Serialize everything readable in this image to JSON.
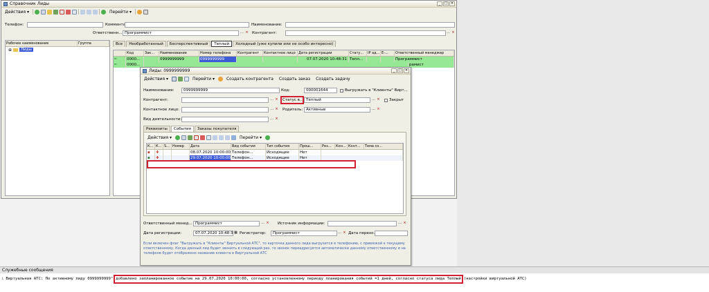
{
  "main_window": {
    "title": "Справочник Лиды",
    "toolbar": {
      "actions_label": "Действия",
      "goto_label": "Перейти"
    },
    "filters": {
      "phone_label": "Телефон:",
      "comment_label": "Комментарий:",
      "name_label": "Наименование:",
      "responsible_label": "Ответственн...",
      "responsible_value": "Программист",
      "counterparty_label": "Контрагент:"
    },
    "tree": {
      "col_name": "Рабочее наименование",
      "col_group": "Группа",
      "root_label": "Лиды"
    },
    "status_tabs": [
      "Все",
      "Необработанный",
      "Бесперспективный",
      "Теплый",
      "Холодный (уже купили или не особо интересно)"
    ],
    "columns": [
      "Код",
      "Зак...",
      "Наименование",
      "Номер телефона",
      "Контрагент",
      "Контактное лицо",
      "Дата регистрации",
      "Стату...",
      "IP ад...",
      "Е-...",
      "Ответственный менеджер"
    ],
    "rows": [
      {
        "code": "0000...",
        "name": "0999999999",
        "phone": "0999999999",
        "date": "07.07.2020 10:48:31",
        "status": "Тепл...",
        "manager": "Программист"
      },
      {
        "code": "0000...",
        "manager": "рамист"
      }
    ]
  },
  "lead_window": {
    "title": "Лиды: 0999999999",
    "toolbar": {
      "actions_label": "Действия",
      "goto_label": "Перейти",
      "create_counterparty": "Создать контрагента",
      "create_order": "Создать заказ",
      "create_task": "Создать задачу"
    },
    "form": {
      "name_label": "Наименование:",
      "name_value": "0999999999",
      "code_label": "Код:",
      "code_value": "000001644",
      "export_label": "Выгружать в \"Клиенты\" Вирт...",
      "counterparty_label": "Контрагент:",
      "status_label": "Статус в...",
      "status_value": "Теплый",
      "closed_label": "Закрыт",
      "contact_label": "Контактное лицо:",
      "parent_label": "Родитель:",
      "parent_value": "Активные",
      "activity_label": "Вид деятельности:"
    },
    "tabs": [
      "Реквизиты",
      "События",
      "Заказы покупателя"
    ],
    "events_toolbar": {
      "actions_label": "Действия",
      "goto_label": "Перейти"
    },
    "events_columns": [
      "К...",
      "К...",
      "S...",
      "Номер",
      "Дата",
      "Вид события",
      "Тип события",
      "Прош...",
      "Рез...",
      "Кон...",
      "Конт...",
      "Тема со..."
    ],
    "events_rows": [
      {
        "number": "",
        "date": "08.07.2020 10:00:00",
        "kind": "Телефон...",
        "type": "Исходящее",
        "passed": "Нет"
      },
      {
        "number": "",
        "date": "29.07.2020 10:00:00",
        "kind": "Телефон...",
        "type": "Исходящее",
        "passed": "Нет"
      }
    ],
    "bottom": {
      "responsible_label": "Ответственный менед...",
      "responsible_value": "Программист",
      "source_label": "Источник информации:",
      "reg_date_label": "Дата регистрации:",
      "reg_date_value": "07.07.2020 10:48:3",
      "registrar_label": "Регистратор:",
      "registrar_value": "Программист",
      "transfer_label": "Дата перехо...",
      "note": "Если включен флаг \"Выгружать в \"Клиенты\" Виртуальной АТС\", то карточка данного лида выгрузится в телефонию, с привязкой к текущему ответственному. Когда данный лид будет звонить в следующий раз, то звонок переадресуется автоматически данному ответственному и на телефоне будет отображено название клиента в Виртуальной АТС"
    }
  },
  "messages": {
    "title": "Служебные сообщения",
    "line_prefix": "Виртуальная АТС: По активному лиду 0999999999\"",
    "line_highlight": "добавлено запланированное событие на 29.07.2020 10:00:00, согласно установленному периоду планирования событий =1 дней, согласно статуса лида Теплый",
    "line_suffix": "(настройки виртуальной АТС)"
  },
  "colors": {
    "selected_row": "#97e895",
    "highlight_red": "#d11f31",
    "selection_blue": "#3d5bd6"
  }
}
